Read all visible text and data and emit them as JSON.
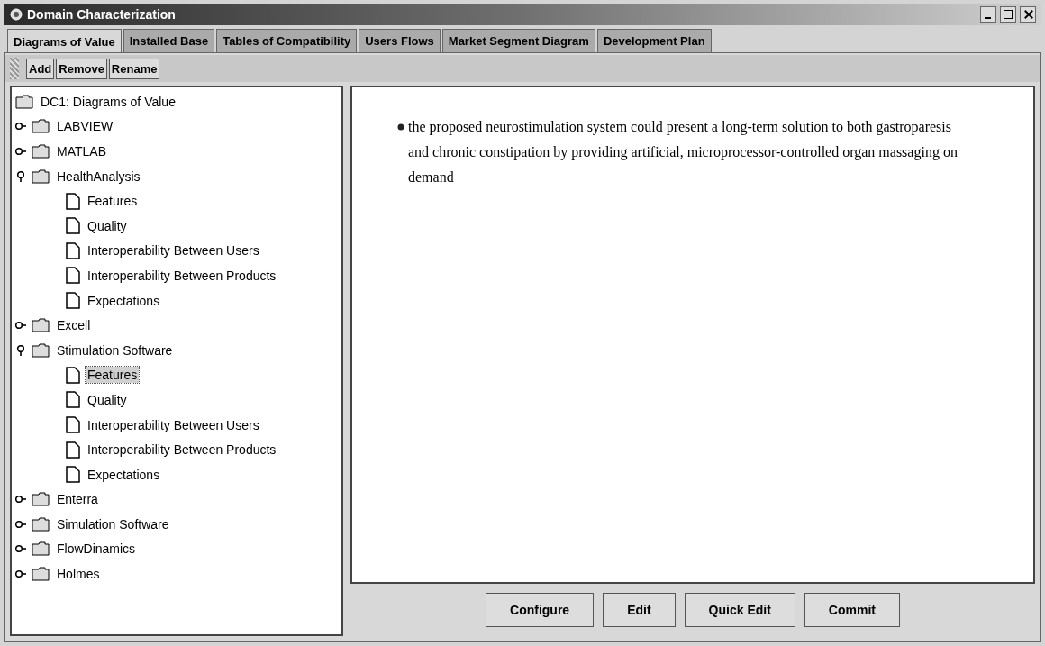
{
  "window": {
    "title": "Domain Characterization"
  },
  "tabs": [
    {
      "label": "Diagrams of Value",
      "selected": true
    },
    {
      "label": "Installed Base",
      "selected": false
    },
    {
      "label": "Tables of Compatibility",
      "selected": false
    },
    {
      "label": "Users Flows",
      "selected": false
    },
    {
      "label": "Market Segment Diagram",
      "selected": false
    },
    {
      "label": "Development Plan",
      "selected": false
    }
  ],
  "toolbar": [
    "Add",
    "Remove",
    "Rename"
  ],
  "tree": {
    "label": "DC1: Diagrams of Value",
    "children": [
      {
        "label": "LABVIEW",
        "expanded": false
      },
      {
        "label": "MATLAB",
        "expanded": false
      },
      {
        "label": "HealthAnalysis",
        "expanded": true,
        "children": [
          {
            "label": "Features",
            "selected": false
          },
          {
            "label": "Quality",
            "selected": false
          },
          {
            "label": "Interoperability Between Users",
            "selected": false
          },
          {
            "label": "Interoperability Between Products",
            "selected": false
          },
          {
            "label": "Expectations",
            "selected": false
          }
        ]
      },
      {
        "label": "Excell",
        "expanded": false
      },
      {
        "label": "Stimulation Software",
        "expanded": true,
        "children": [
          {
            "label": "Features",
            "selected": true
          },
          {
            "label": "Quality",
            "selected": false
          },
          {
            "label": "Interoperability Between Users",
            "selected": false
          },
          {
            "label": "Interoperability Between Products",
            "selected": false
          },
          {
            "label": "Expectations",
            "selected": false
          }
        ]
      },
      {
        "label": "Enterra",
        "expanded": false
      },
      {
        "label": "Simulation Software",
        "expanded": false
      },
      {
        "label": "FlowDinamics",
        "expanded": false
      },
      {
        "label": "Holmes",
        "expanded": false
      }
    ]
  },
  "content": {
    "bullets": [
      "the proposed neurostimulation system could present a long-term solution to both gastroparesis and chronic constipation by providing artificial, microprocessor-controlled organ massaging on demand"
    ]
  },
  "buttons": [
    "Configure",
    "Edit",
    "Quick Edit",
    "Commit"
  ]
}
